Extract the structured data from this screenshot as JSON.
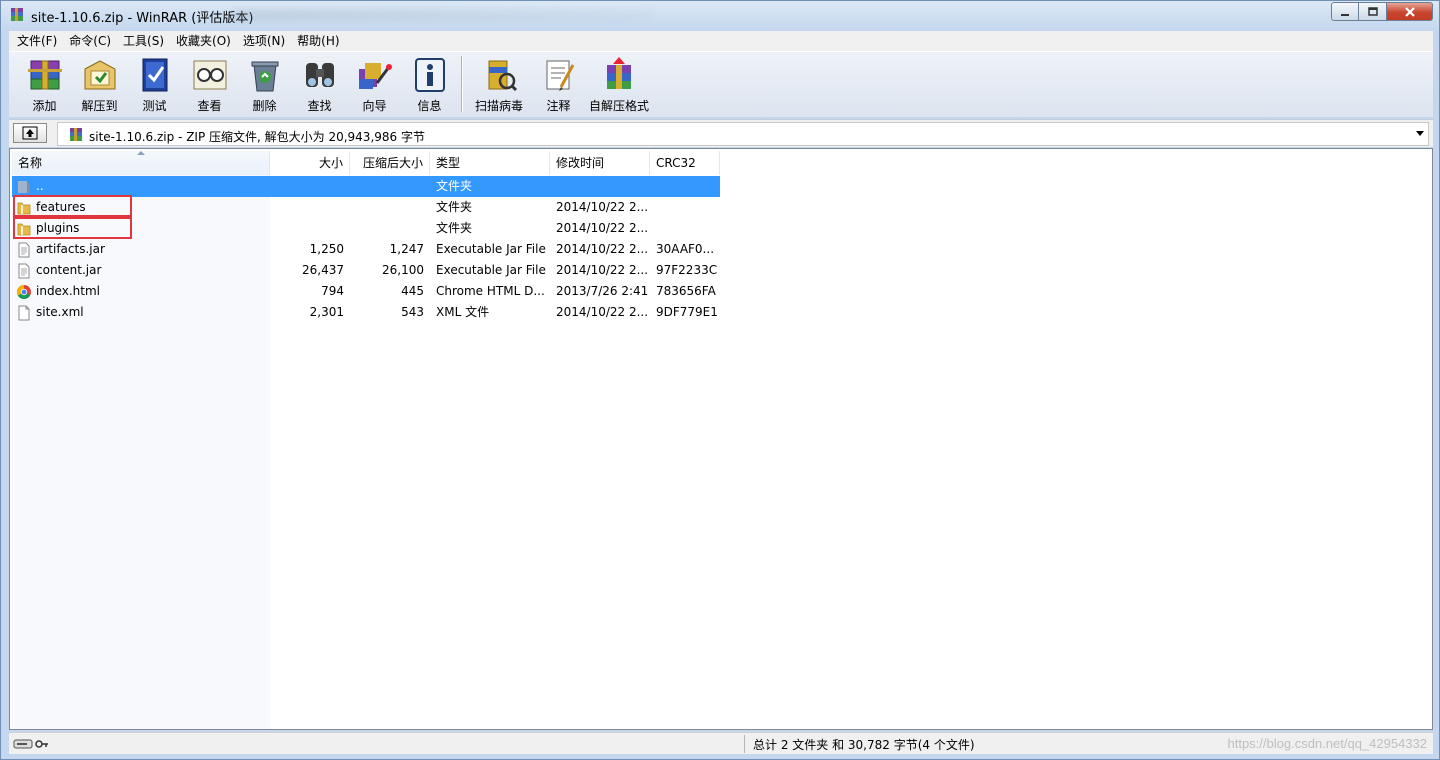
{
  "window": {
    "title": "site-1.10.6.zip - WinRAR (评估版本)",
    "controls": [
      "minimize",
      "maximize",
      "close"
    ]
  },
  "menu": [
    "文件(F)",
    "命令(C)",
    "工具(S)",
    "收藏夹(O)",
    "选项(N)",
    "帮助(H)"
  ],
  "toolbar": [
    {
      "label": "添加",
      "icon": "add-archive-icon"
    },
    {
      "label": "解压到",
      "icon": "extract-to-icon"
    },
    {
      "label": "测试",
      "icon": "test-icon"
    },
    {
      "label": "查看",
      "icon": "view-icon"
    },
    {
      "label": "删除",
      "icon": "delete-icon"
    },
    {
      "label": "查找",
      "icon": "find-icon"
    },
    {
      "label": "向导",
      "icon": "wizard-icon"
    },
    {
      "label": "信息",
      "icon": "info-icon"
    },
    {
      "label": "扫描病毒",
      "icon": "virus-scan-icon"
    },
    {
      "label": "注释",
      "icon": "comment-icon"
    },
    {
      "label": "自解压格式",
      "icon": "sfx-icon"
    }
  ],
  "address": {
    "text": "site-1.10.6.zip - ZIP 压缩文件, 解包大小为 20,943,986 字节"
  },
  "columns": {
    "name": "名称",
    "size": "大小",
    "packed": "压缩后大小",
    "type": "类型",
    "modified": "修改时间",
    "crc": "CRC32"
  },
  "files": [
    {
      "name": "..",
      "size": "",
      "packed": "",
      "type": "文件夹",
      "modified": "",
      "crc": "",
      "icon": "parent-folder-icon",
      "selected": true
    },
    {
      "name": "features",
      "size": "",
      "packed": "",
      "type": "文件夹",
      "modified": "2014/10/22 2...",
      "crc": "",
      "icon": "folder-icon",
      "selected": false
    },
    {
      "name": "plugins",
      "size": "",
      "packed": "",
      "type": "文件夹",
      "modified": "2014/10/22 2...",
      "crc": "",
      "icon": "folder-icon",
      "selected": false
    },
    {
      "name": "artifacts.jar",
      "size": "1,250",
      "packed": "1,247",
      "type": "Executable Jar File",
      "modified": "2014/10/22 2...",
      "crc": "30AAF0...",
      "icon": "jar-file-icon",
      "selected": false
    },
    {
      "name": "content.jar",
      "size": "26,437",
      "packed": "26,100",
      "type": "Executable Jar File",
      "modified": "2014/10/22 2...",
      "crc": "97F2233C",
      "icon": "jar-file-icon",
      "selected": false
    },
    {
      "name": "index.html",
      "size": "794",
      "packed": "445",
      "type": "Chrome HTML D...",
      "modified": "2013/7/26 2:41",
      "crc": "783656FA",
      "icon": "chrome-html-icon",
      "selected": false
    },
    {
      "name": "site.xml",
      "size": "2,301",
      "packed": "543",
      "type": "XML 文件",
      "modified": "2014/10/22 2...",
      "crc": "9DF779E1",
      "icon": "xml-file-icon",
      "selected": false
    }
  ],
  "status": {
    "summary": "总计 2 文件夹 和 30,782 字节(4 个文件)",
    "watermark": "https://blog.csdn.net/qq_42954332"
  },
  "colors": {
    "selection": "#3399ff",
    "highlight_box": "#e2353f",
    "folder": "#e8b84a"
  }
}
